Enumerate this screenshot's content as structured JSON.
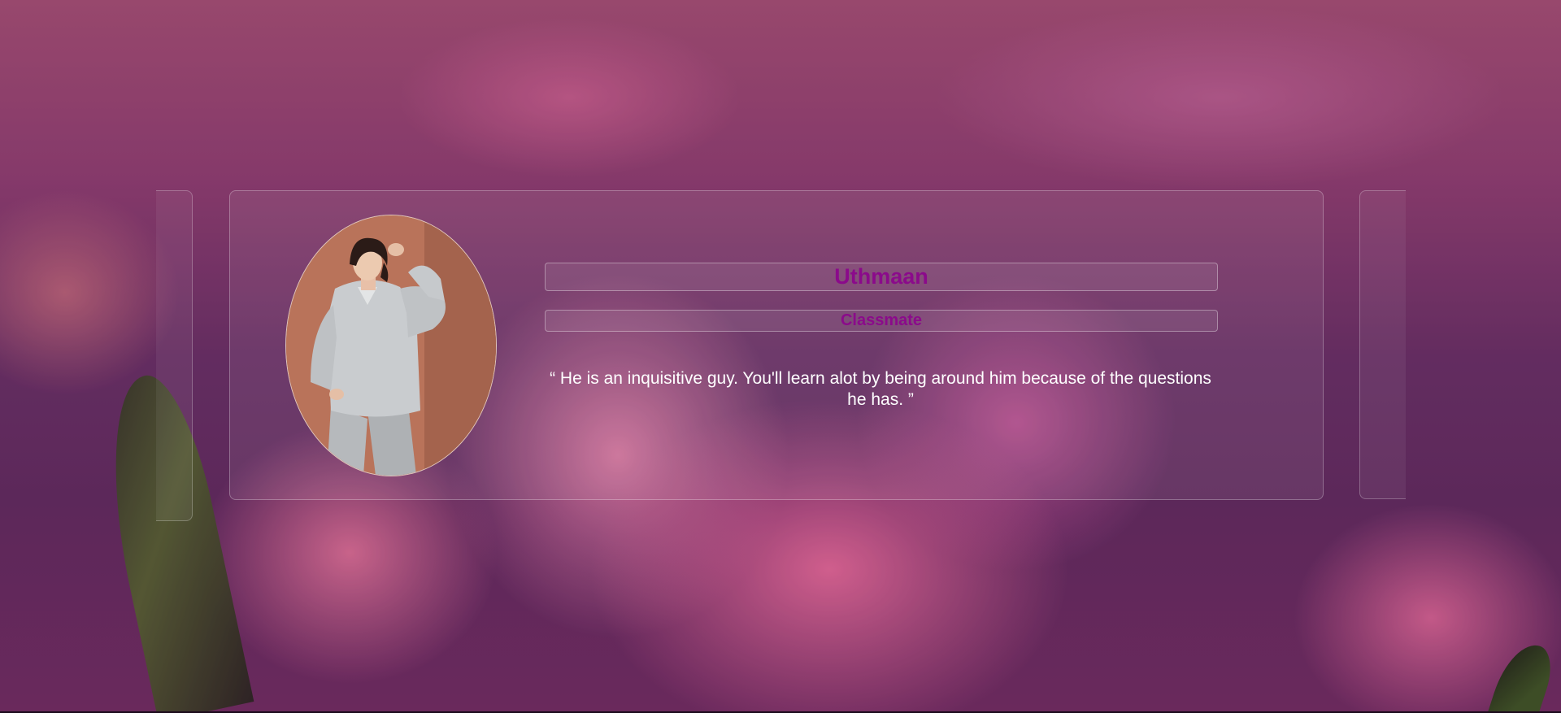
{
  "testimonial": {
    "name": "Uthmaan",
    "role": "Classmate",
    "quote": "“ He is an inquisitive guy. You'll learn alot by being around him because of the questions he has. ”"
  },
  "colors": {
    "accent": "#8b0a8b",
    "quote_text": "#ffffff"
  }
}
